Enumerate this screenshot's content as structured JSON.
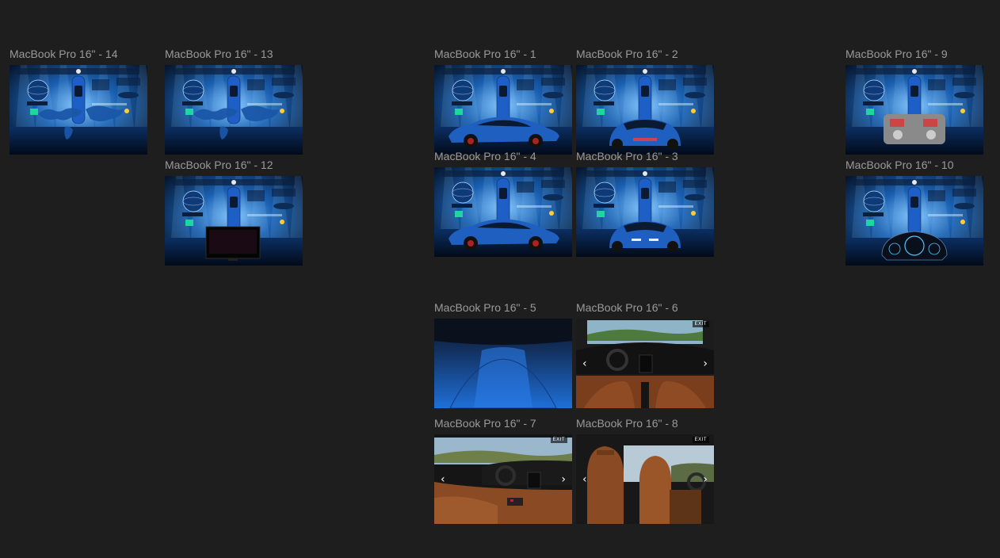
{
  "canvas": {
    "background": "#1e1e1e"
  },
  "frames": [
    {
      "id": "mbp14",
      "label": "MacBook Pro 16\" - 14",
      "scene": "dashboard",
      "overlay": "world-map"
    },
    {
      "id": "mbp13",
      "label": "MacBook Pro 16\" - 13",
      "scene": "dashboard",
      "overlay": "world-map"
    },
    {
      "id": "mbp12",
      "label": "MacBook Pro 16\" - 12",
      "scene": "dashboard",
      "overlay": "monitor"
    },
    {
      "id": "mbp1",
      "label": "MacBook Pro 16\" - 1",
      "scene": "dashboard",
      "overlay": "car-side"
    },
    {
      "id": "mbp2",
      "label": "MacBook Pro 16\" - 2",
      "scene": "dashboard",
      "overlay": "car-rear"
    },
    {
      "id": "mbp4",
      "label": "MacBook Pro 16\" - 4",
      "scene": "dashboard",
      "overlay": "car-side"
    },
    {
      "id": "mbp3",
      "label": "MacBook Pro 16\" - 3",
      "scene": "dashboard",
      "overlay": "car-front"
    },
    {
      "id": "mbp9",
      "label": "MacBook Pro 16\" - 9",
      "scene": "dashboard",
      "overlay": "engine"
    },
    {
      "id": "mbp10",
      "label": "MacBook Pro 16\" - 10",
      "scene": "dashboard",
      "overlay": "gauge"
    },
    {
      "id": "mbp5",
      "label": "MacBook Pro 16\" - 5",
      "scene": "hood"
    },
    {
      "id": "mbp6",
      "label": "MacBook Pro 16\" - 6",
      "scene": "cockpit",
      "exit": "EXIT"
    },
    {
      "id": "mbp7",
      "label": "MacBook Pro 16\" - 7",
      "scene": "cabin-side",
      "exit": "EXIT"
    },
    {
      "id": "mbp8",
      "label": "MacBook Pro 16\" - 8",
      "scene": "seats",
      "exit": "EXIT"
    }
  ],
  "colors": {
    "label": "#9a9a9a",
    "dashboard_blue": "#1b6fd1",
    "interior_leather": "#8a4a24",
    "hood_blue": "#1f6fd8"
  },
  "icons": {
    "prev": "chevron-left-icon",
    "next": "chevron-right-icon"
  }
}
